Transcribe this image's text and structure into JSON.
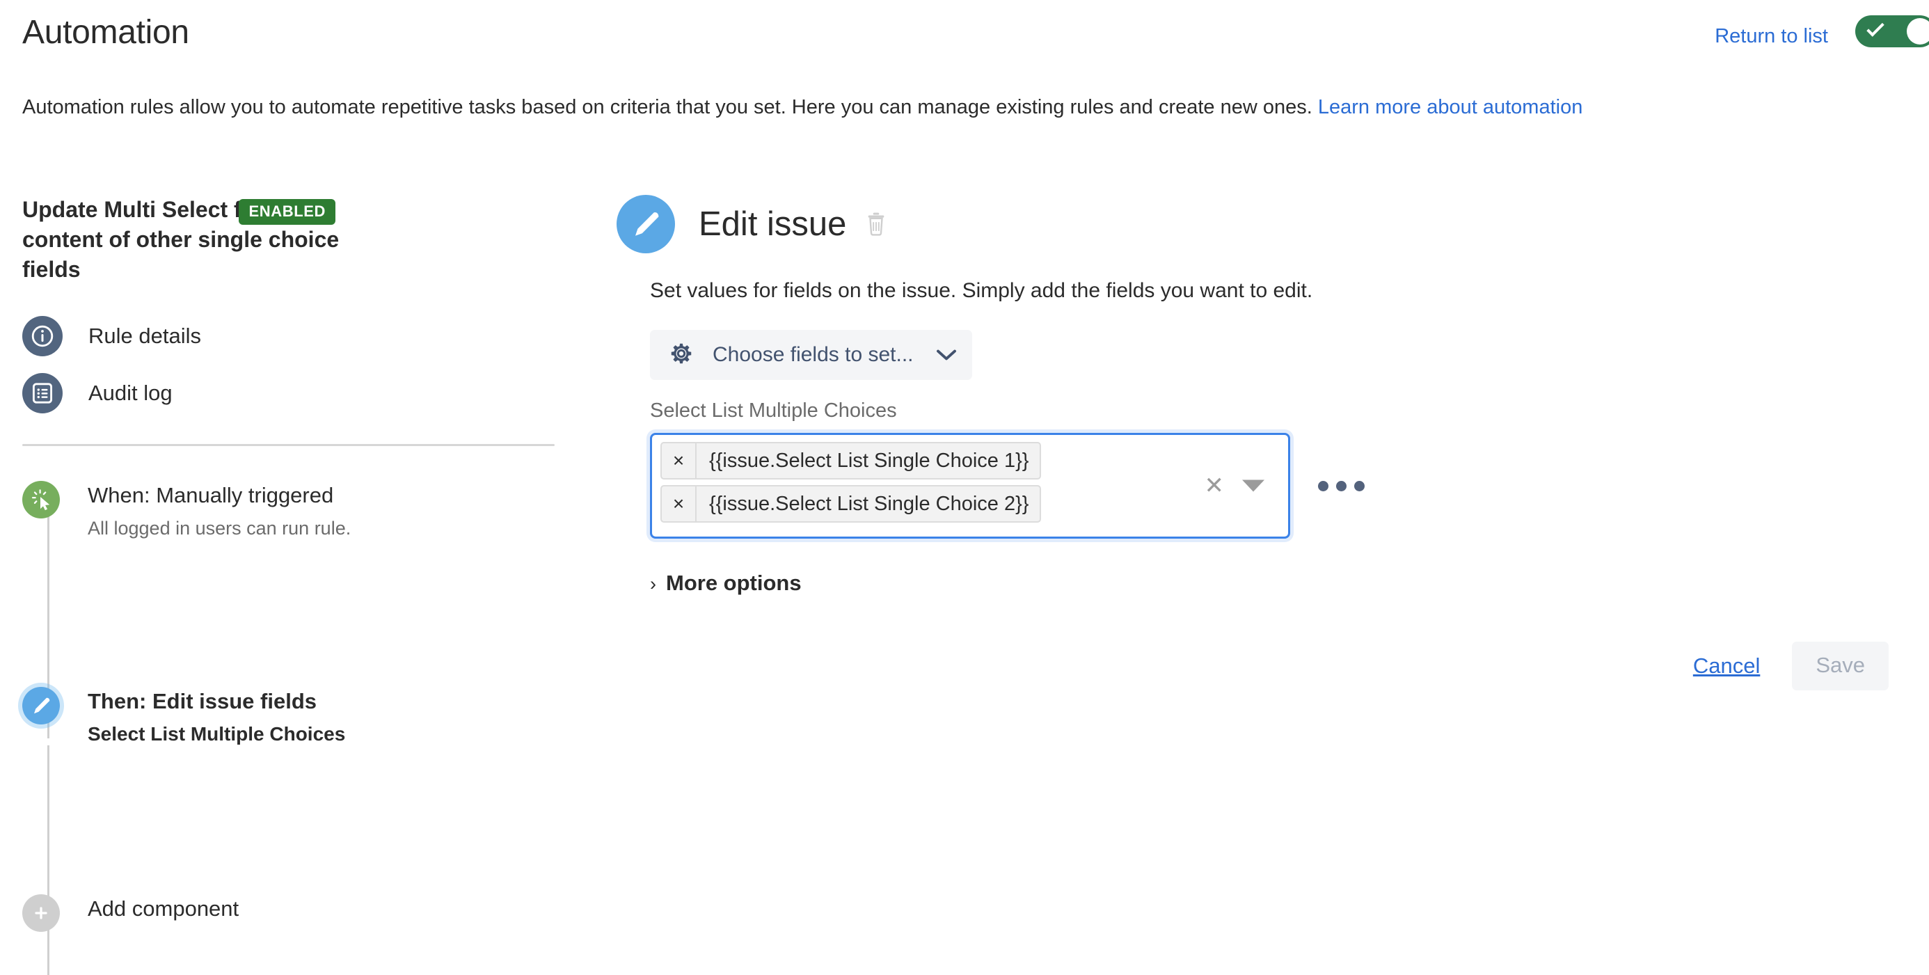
{
  "header": {
    "title": "Automation",
    "return_link": "Return to list",
    "toggle_state": "on",
    "toggle_color": "#2f7d50"
  },
  "description": {
    "text_before": "Automation rules allow you to automate repetitive tasks based on criteria that you set. Here you can manage existing rules and create new ones. ",
    "link_text": "Learn more about automation"
  },
  "sidebar": {
    "rule_name": "Update Multi Select field with content of other single choice fields",
    "status_badge": "ENABLED",
    "status_badge_color": "#2e7d32",
    "nav_items": [
      {
        "label": "Rule details",
        "icon": "info-icon"
      },
      {
        "label": "Audit log",
        "icon": "list-document-icon"
      }
    ],
    "flow": [
      {
        "id": "when",
        "title": "When: Manually triggered",
        "subtitle": "All logged in users can run rule.",
        "icon": "cursor-click-icon",
        "color": "#77ae5d"
      },
      {
        "id": "then",
        "title": "Then: Edit issue fields",
        "subtitle": "Select List Multiple Choices",
        "icon": "pencil-icon",
        "color": "#5ba8e5",
        "selected": true
      },
      {
        "id": "add",
        "title": "Add component",
        "subtitle": "",
        "icon": "plus-icon",
        "color": "#cfcfcf"
      }
    ]
  },
  "main": {
    "title": "Edit issue",
    "icon": "pencil-icon",
    "delete_icon": "trash-icon",
    "description": "Set values for fields on the issue. Simply add the fields you want to edit.",
    "choose_fields_button": {
      "label": "Choose fields to set...",
      "icon": "gear-icon",
      "caret_icon": "chevron-down-icon"
    },
    "field": {
      "label": "Select List Multiple Choices",
      "tags": [
        {
          "text": "{{issue.Select List Single Choice 1}}",
          "remove_label": "×"
        },
        {
          "text": "{{issue.Select List Single Choice 2}}",
          "remove_label": "×"
        }
      ],
      "clear_label": "✕",
      "caret_icon": "dropdown-caret-icon",
      "overflow_icon": "ellipsis-icon",
      "focused": true,
      "focus_color": "#3b82e8"
    },
    "more_options": {
      "chevron": "›",
      "label": "More options"
    },
    "actions": {
      "cancel_label": "Cancel",
      "save_label": "Save",
      "save_disabled": true
    }
  }
}
